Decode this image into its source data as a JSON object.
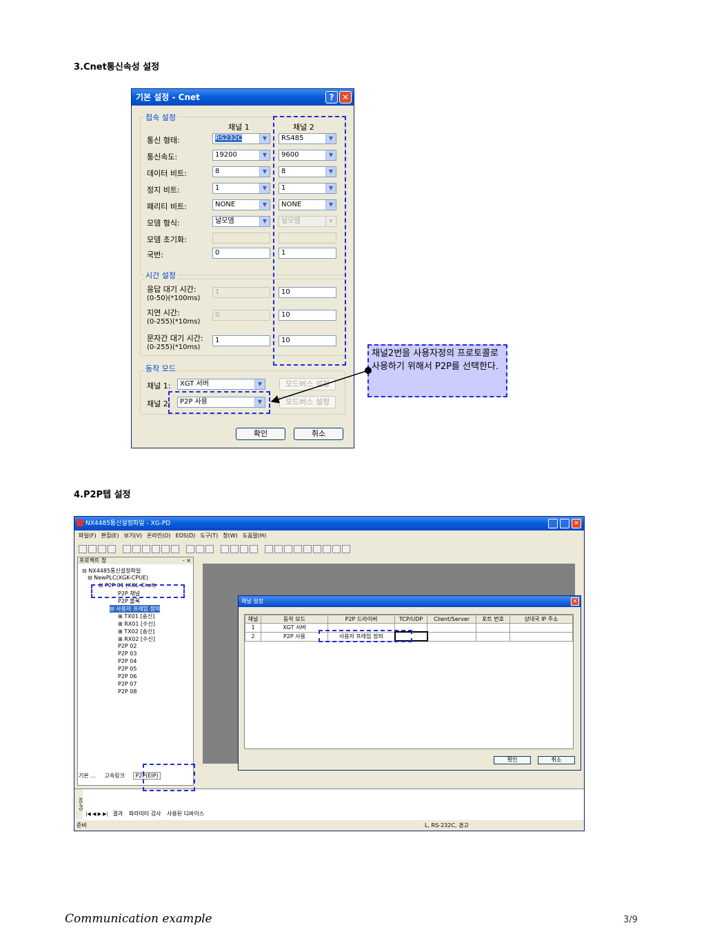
{
  "section3": {
    "title": "3.Cnet통신속성 설정"
  },
  "dialog1": {
    "title": "기본 설정 - Cnet",
    "help_glyph": "?",
    "close_glyph": "✕",
    "conn_group": "접속 설정",
    "ch1_header": "채널 1",
    "ch2_header": "채널 2",
    "rows": [
      {
        "label": "통신 형태:",
        "ch1": "RS232C",
        "ch2": "RS485"
      },
      {
        "label": "통신속도:",
        "ch1": "19200",
        "ch2": "9600"
      },
      {
        "label": "데이터 비트:",
        "ch1": "8",
        "ch2": "8"
      },
      {
        "label": "정지 비트:",
        "ch1": "1",
        "ch2": "1"
      },
      {
        "label": "패리티 비트:",
        "ch1": "NONE",
        "ch2": "NONE"
      },
      {
        "label": "모뎀 형식:",
        "ch1": "널모뎀",
        "ch2": "널모뎀"
      },
      {
        "label": "모뎀 초기화:",
        "ch1": "",
        "ch2": ""
      },
      {
        "label": "국번:",
        "ch1": "0",
        "ch2": "1"
      }
    ],
    "time_group": "시간 설정",
    "time_rows": [
      {
        "label1": "응답 대기 시간:",
        "label2": "(0-50)(*100ms)",
        "ch1": "1",
        "ch2": "10"
      },
      {
        "label1": "지연 시간:",
        "label2": "(0-255)(*10ms)",
        "ch1": "0",
        "ch2": "10"
      },
      {
        "label1": "문자간 대기 시간:",
        "label2": "(0-255)(*10ms)",
        "ch1": "1",
        "ch2": "10"
      }
    ],
    "mode_group": "동작 모드",
    "mode_rows": [
      {
        "label": "채널 1:",
        "value": "XGT 서버",
        "button": "모드버스 설정"
      },
      {
        "label": "채널 2:",
        "value": "P2P 사용",
        "button": "모드버스 설정"
      }
    ],
    "ok": "확인",
    "cancel": "취소"
  },
  "callout": {
    "text": "채널2번을 사용자정의 프로토콜로 사용하기 위해서 P2P를 선택한다."
  },
  "section4": {
    "title": "4.P2P텝 설정"
  },
  "xgpd": {
    "title": "NX4485통신설정파일 - XG-PD",
    "menu": [
      "파일(F)",
      "편집(E)",
      "보기(V)",
      "온라인(O)",
      "EDS(D)",
      "도구(T)",
      "창(W)",
      "도움말(H)"
    ],
    "project_pane_title": "프로젝트 창",
    "pane_controls": "- ×",
    "tree": [
      {
        "text": "⊟ NX4485통신설정파일",
        "level": 0
      },
      {
        "text": "⊟ NewPLC(XGK-CPUE)",
        "level": 1
      },
      {
        "text": "⊟ P2P 01 (XGL-Cnet)",
        "level": 2
      },
      {
        "text": "P2P 채널",
        "level": 3
      },
      {
        "text": "P2P 블록",
        "level": 3
      },
      {
        "text": "⊟ 사용자 프레임 정의",
        "level": 3,
        "selected": true
      },
      {
        "text": "⊞ TX01 [송신]",
        "level": 4
      },
      {
        "text": "⊞ RX01 [수신]",
        "level": 4
      },
      {
        "text": "⊞ TX02 [송신]",
        "level": 4
      },
      {
        "text": "⊞ RX02 [수신]",
        "level": 4
      },
      {
        "text": "P2P 02",
        "level": 2
      },
      {
        "text": "P2P 03",
        "level": 2
      },
      {
        "text": "P2P 04",
        "level": 2
      },
      {
        "text": "P2P 05",
        "level": 2
      },
      {
        "text": "P2P 06",
        "level": 2
      },
      {
        "text": "P2P 07",
        "level": 2
      },
      {
        "text": "P2P 08",
        "level": 2
      }
    ],
    "bottom_tabs": [
      "기본 ...",
      "고속링크",
      "P2P(EIP)"
    ],
    "channel_dialog": {
      "title": "채널 설정",
      "columns": [
        "채널",
        "동작 모드",
        "P2P 드라이버",
        "TCP/UDP",
        "Client/Server",
        "포트 번호",
        "상대국 IP 주소"
      ],
      "rows": [
        [
          "1",
          "XGT 서버",
          "",
          "",
          "",
          "",
          ""
        ],
        [
          "2",
          "P2P 사용",
          "사용자 프레임 정의",
          "",
          "",
          "",
          ""
        ]
      ],
      "ok": "확인",
      "cancel": "취소"
    },
    "output_tabs": [
      "결과",
      "파라미터 검사",
      "사용된 디바이스"
    ],
    "output_side_label": "XG-PD",
    "status_left": "준비",
    "status_right": "L, RS-232C, 경고"
  },
  "footer": {
    "left": "Communication example",
    "page": "3/9"
  }
}
